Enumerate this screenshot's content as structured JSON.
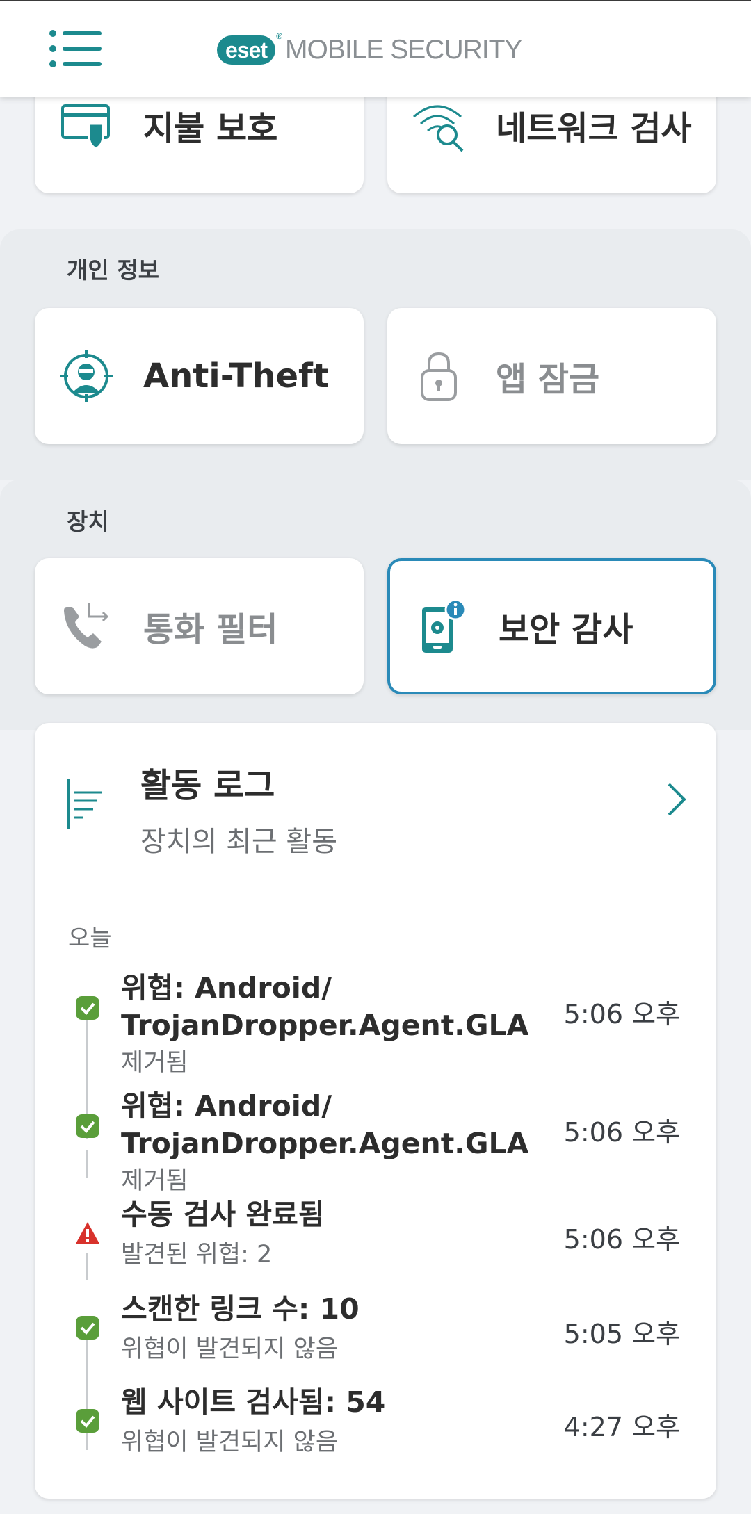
{
  "header": {
    "logo_badge": "eset",
    "logo_text": "MOBILE SECURITY"
  },
  "tiles_top": {
    "payment_protection": "지불 보호",
    "network_inspector": "네트워크 검사"
  },
  "sections": {
    "privacy": {
      "label": "개인 정보",
      "anti_theft": "Anti-Theft",
      "app_lock": "앱 잠금"
    },
    "device": {
      "label": "장치",
      "call_filter": "통화 필터",
      "security_audit": "보안 감사"
    }
  },
  "activity_log": {
    "title": "활동 로그",
    "subtitle": "장치의 최근 활동",
    "day_label": "오늘",
    "entries": [
      {
        "status": "ok",
        "title": "위협: Android/ TrojanDropper.Agent.GLA",
        "desc": "제거됨",
        "time": "5:06 오후"
      },
      {
        "status": "ok",
        "title": "위협: Android/ TrojanDropper.Agent.GLA",
        "desc": "제거됨",
        "time": "5:06 오후"
      },
      {
        "status": "warning",
        "title": "수동 검사 완료됨",
        "desc": "발견된 위협: 2",
        "time": "5:06 오후"
      },
      {
        "status": "ok",
        "title": "스캔한 링크 수: 10",
        "desc": "위협이 발견되지 않음",
        "time": "5:05 오후"
      },
      {
        "status": "ok",
        "title": "웹 사이트 검사됨: 54",
        "desc": "위협이 발견되지 않음",
        "time": "4:27 오후"
      }
    ]
  },
  "colors": {
    "accent": "#1c8a8e",
    "selected_border": "#2a8ab8",
    "ok": "#5a9e3a",
    "warning": "#d8322c"
  }
}
